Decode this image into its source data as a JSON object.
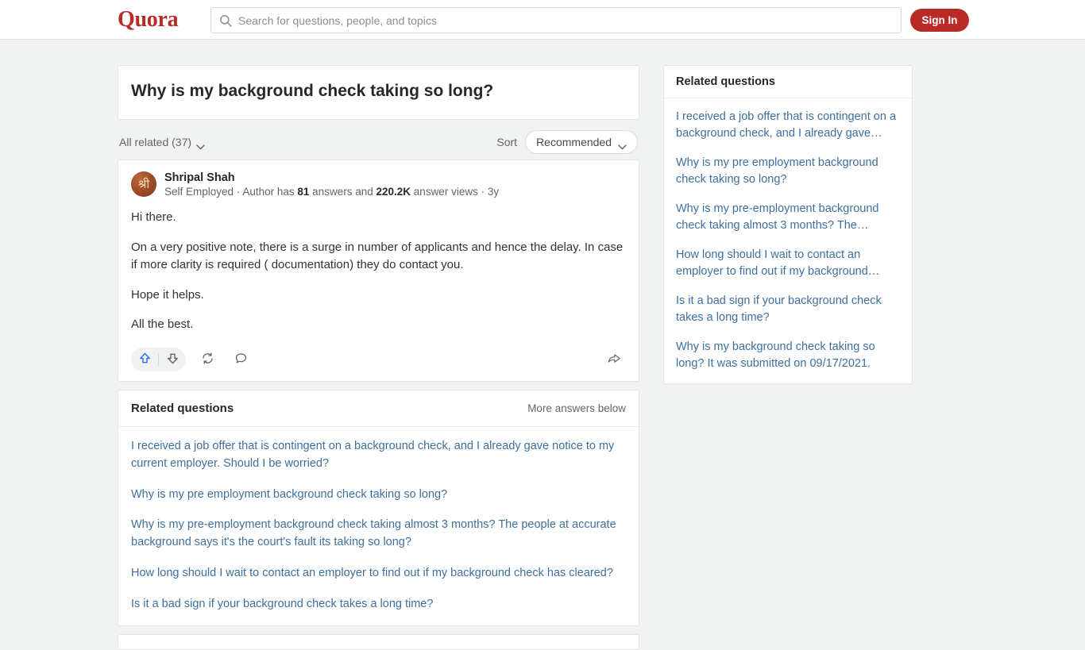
{
  "header": {
    "logo": "Quora",
    "search_placeholder": "Search for questions, people, and topics",
    "search_value": "",
    "signin_label": "Sign In"
  },
  "question": {
    "title": "Why is my background check taking so long?",
    "filter_label": "All related (37)",
    "sort_label": "Sort",
    "sort_value": "Recommended"
  },
  "answer": {
    "author_name": "Shripal Shah",
    "author_avatar_glyph": "श्री",
    "credential": "Self Employed",
    "meta_prefix": "Author has",
    "answers_count": "81",
    "meta_mid": "answers and",
    "views_count": "220.2K",
    "meta_suffix": "answer views",
    "time_ago": "3y",
    "paragraphs": [
      "Hi there.",
      "On a very positive note, there is a surge in number of applicants and hence the delay. In case if more clarity is required ( documentation) they do contact you.",
      "Hope it helps.",
      "All the best."
    ]
  },
  "related_main": {
    "title": "Related questions",
    "more_label": "More answers below",
    "items": [
      "I received a job offer that is contingent on a background check, and I already gave notice to my current employer. Should I be worried?",
      "Why is my pre employment background check taking so long?",
      "Why is my pre-employment background check taking almost 3 months? The people at accurate background says it's the court's fault its taking so long?",
      "How long should I wait to contact an employer to find out if my background check has cleared?",
      "Is it a bad sign if your background check takes a long time?"
    ]
  },
  "related_sidebar": {
    "title": "Related questions",
    "items": [
      "I received a job offer that is contingent on a background check, and I already gave…",
      "Why is my pre employment background check taking so long?",
      "Why is my pre-employment background check taking almost 3 months? The…",
      "How long should I wait to contact an employer to find out if my background…",
      "Is it a bad sign if your background check takes a long time?",
      "Why is my background check taking so long? It was submitted on 09/17/2021."
    ]
  },
  "colors": {
    "brand": "#b92b27",
    "link": "#3f6f9e",
    "upvote": "#2e69ff",
    "page_bg": "#f1f2f2"
  }
}
